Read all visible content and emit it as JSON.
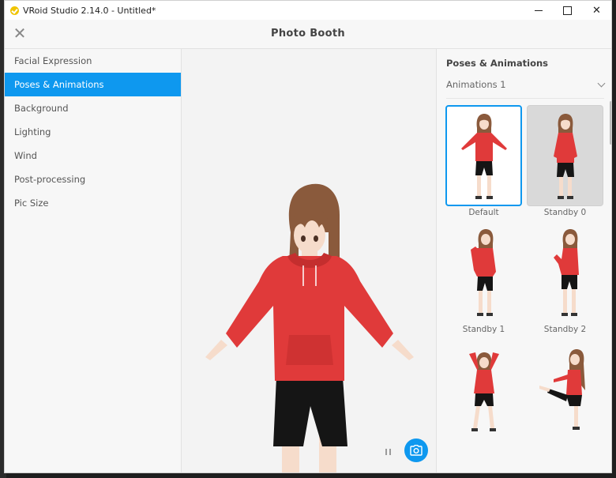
{
  "window": {
    "title": "VRoid Studio 2.14.0 - Untitled*"
  },
  "header": {
    "title": "Photo Booth"
  },
  "sidebar": {
    "items": [
      {
        "label": "Facial Expression",
        "active": false
      },
      {
        "label": "Poses & Animations",
        "active": true
      },
      {
        "label": "Background",
        "active": false
      },
      {
        "label": "Lighting",
        "active": false
      },
      {
        "label": "Wind",
        "active": false
      },
      {
        "label": "Post-processing",
        "active": false
      },
      {
        "label": "Pic Size",
        "active": false
      }
    ]
  },
  "panel": {
    "title": "Poses & Animations",
    "dropdown_value": "Animations 1",
    "animations": [
      {
        "label": "Default",
        "state": "selected"
      },
      {
        "label": "Standby 0",
        "state": "hovered"
      },
      {
        "label": "Standby 1",
        "state": "normal"
      },
      {
        "label": "Standby 2",
        "state": "normal"
      },
      {
        "label": "",
        "state": "normal"
      },
      {
        "label": "",
        "state": "normal"
      }
    ]
  },
  "colors": {
    "accent": "#0e98ef",
    "hoodie": "#e03a3a",
    "hair": "#8a5a3c",
    "shorts": "#151515",
    "skin": "#f6dccb"
  },
  "icons": [
    "app-logo-icon",
    "minimize-icon",
    "maximize-icon",
    "close-icon",
    "chevron-down-icon",
    "pause-icon",
    "camera-icon"
  ]
}
